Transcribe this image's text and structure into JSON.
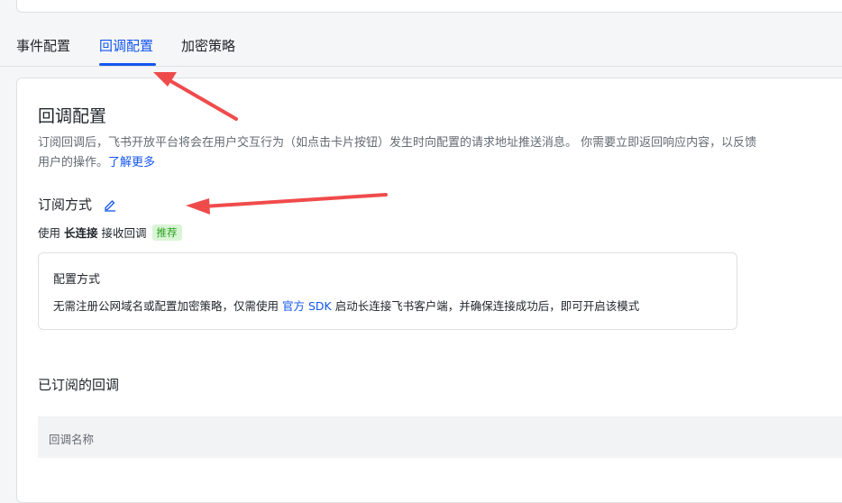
{
  "tabs": [
    {
      "label": "事件配置",
      "active": false
    },
    {
      "label": "回调配置",
      "active": true
    },
    {
      "label": "加密策略",
      "active": false
    }
  ],
  "section": {
    "title": "回调配置",
    "description": "订阅回调后，飞书开放平台将会在用户交互行为（如点击卡片按钮）发生时向配置的请求地址推送消息。 你需要立即返回响应内容，以反馈用户的操作。",
    "learn_more": "了解更多"
  },
  "subscription": {
    "title": "订阅方式",
    "edit_icon": "pencil-edit-icon",
    "method_prefix": "使用",
    "method_bold": "长连接",
    "method_suffix": "接收回调",
    "badge": "推荐"
  },
  "config_box": {
    "title": "配置方式",
    "text_before": "无需注册公网域名或配置加密策略，仅需使用",
    "link": "官方 SDK",
    "text_after": "启动长连接飞书客户端，并确保连接成功后，即可开启该模式"
  },
  "subscribed": {
    "title": "已订阅的回调",
    "column_header": "回调名称"
  },
  "colors": {
    "accent": "#1456f0",
    "arrow": "#f04b4b",
    "badge_bg": "#d9f5d6",
    "badge_text": "#2ea121"
  }
}
